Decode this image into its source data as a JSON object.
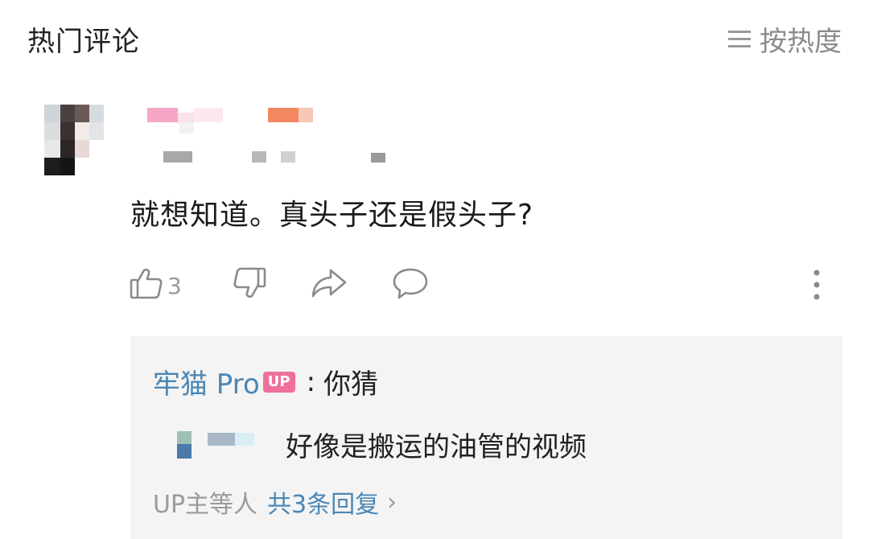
{
  "header": {
    "title": "热门评论",
    "sort_label": "按热度"
  },
  "comment": {
    "content": "就想知道。真头子还是假头子?",
    "like_count": "3"
  },
  "reply_box": {
    "first_reply": {
      "author": "牢猫 Pro",
      "badge": "UP",
      "separator": ":",
      "text": "你猜"
    },
    "second_reply": {
      "text": "好像是搬运的油管的视频"
    },
    "summary": {
      "prefix": "UP主等人",
      "total": "共3条回复",
      "chevron": "›"
    }
  },
  "colors": {
    "accent_blue": "#4b86b4",
    "up_badge_pink": "#ef6f9d",
    "muted_gray": "#9a9a9a",
    "reply_bg": "#f4f4f4"
  }
}
